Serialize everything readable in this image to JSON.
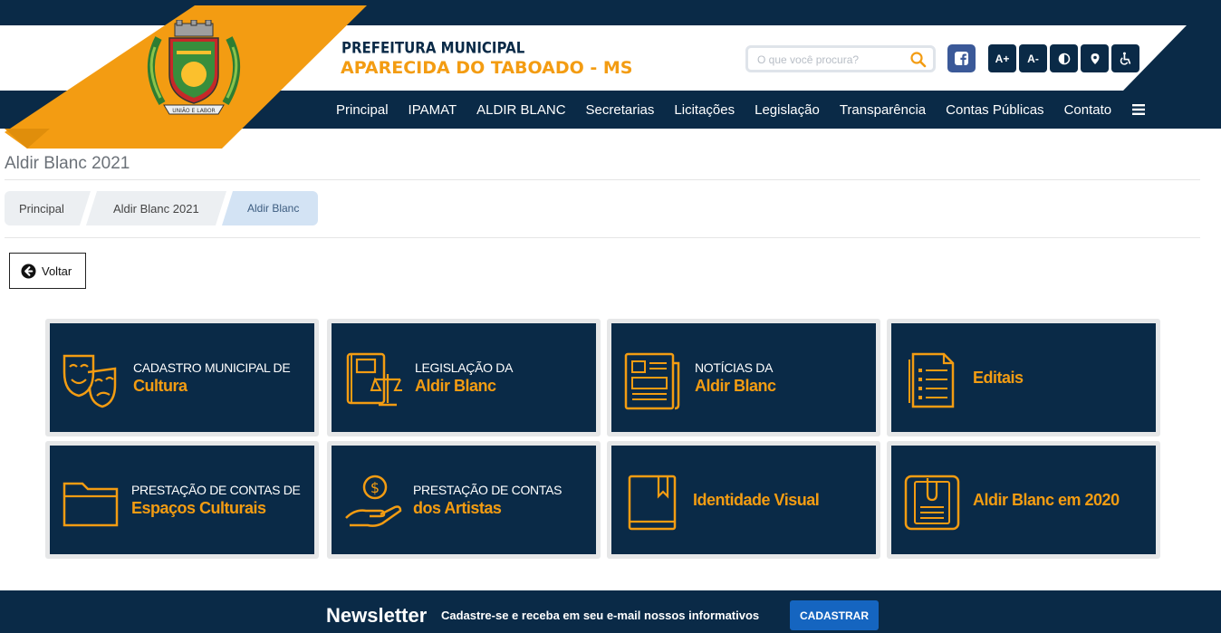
{
  "header": {
    "brand_top": "PREFEITURA MUNICIPAL",
    "brand_main": "APARECIDA DO TABOADO - MS",
    "logo_motto": "UNIÃO E LABOR",
    "search_placeholder": "O que você procura?",
    "accessibility": {
      "increase_font": "A+",
      "decrease_font": "A-"
    }
  },
  "nav": {
    "items": [
      "Principal",
      "IPAMAT",
      "ALDIR BLANC",
      "Secretarias",
      "Licitações",
      "Legislação",
      "Transparência",
      "Contas Públicas",
      "Contato"
    ]
  },
  "page": {
    "title": "Aldir Blanc 2021",
    "breadcrumb": [
      "Principal",
      "Aldir Blanc 2021",
      "Aldir Blanc"
    ],
    "back_label": "Voltar"
  },
  "cards": [
    {
      "line1": "CADASTRO MUNICIPAL DE",
      "line2": "Cultura",
      "icon": "theater-masks-icon"
    },
    {
      "line1": "LEGISLAÇÃO DA",
      "line2": "Aldir Blanc",
      "icon": "law-book-icon"
    },
    {
      "line1": "NOTÍCIAS DA",
      "line2": "Aldir Blanc",
      "icon": "newspaper-icon"
    },
    {
      "single": "Editais",
      "icon": "document-list-icon"
    },
    {
      "line1": "PRESTAÇÃO DE CONTAS DE",
      "line2": "Espaços Culturais",
      "icon": "folder-icon"
    },
    {
      "line1": "PRESTAÇÃO DE CONTAS",
      "line2": "dos Artistas",
      "icon": "money-hand-icon"
    },
    {
      "single": "Identidade Visual",
      "icon": "bookmark-book-icon"
    },
    {
      "single": "Aldir Blanc em 2020",
      "icon": "clipboard-icon"
    }
  ],
  "newsletter": {
    "title": "Newsletter",
    "text": "Cadastre-se e receba em seu e-mail nossos informativos",
    "button": "CADASTRAR"
  },
  "colors": {
    "navy": "#0a2a47",
    "orange": "#f39c12",
    "facebook": "#3b5998",
    "button_blue": "#1565c0"
  }
}
